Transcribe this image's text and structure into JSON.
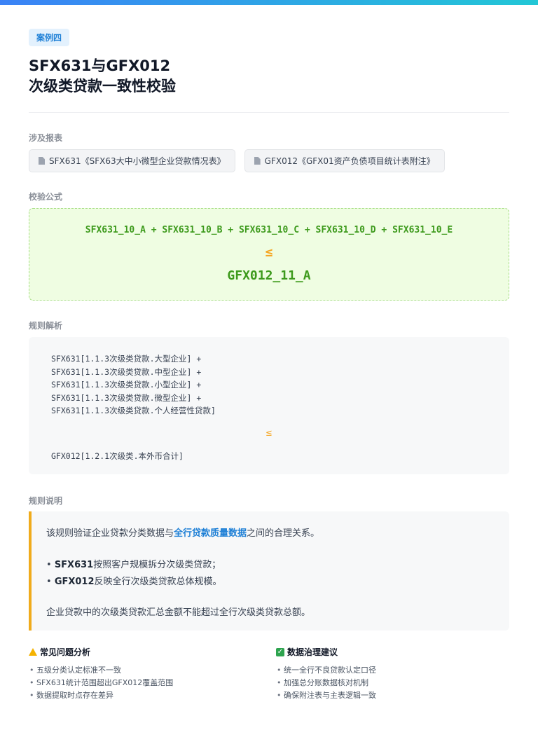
{
  "case_tag": "案例四",
  "title": {
    "line1": "SFX631与GFX012",
    "line2": "次级类贷款一致性校验"
  },
  "sections": {
    "reports": "涉及报表",
    "formula": "校验公式",
    "analysis": "规则解析",
    "description": "规则说明"
  },
  "reports": [
    {
      "label": "SFX631《SFX63大中小微型企业贷款情况表》",
      "icon": "document-icon"
    },
    {
      "label": "GFX012《GFX01资产负债项目统计表附注》",
      "icon": "document-icon"
    }
  ],
  "formula": {
    "top": "SFX631_10_A + SFX631_10_B + SFX631_10_C + SFX631_10_D + SFX631_10_E",
    "op": "≤",
    "result": "GFX012_11_A"
  },
  "analysis": {
    "lines": [
      "SFX631[1.1.3次级类贷款.大型企业] +",
      "SFX631[1.1.3次级类贷款.中型企业] +",
      "SFX631[1.1.3次级类贷款.小型企业] +",
      "SFX631[1.1.3次级类贷款.微型企业] +",
      "SFX631[1.1.3次级类贷款.个人经营性贷款]"
    ],
    "op": "≤",
    "result": "GFX012[1.2.1次级类.本外币合计]"
  },
  "description": {
    "intro_pre": "该规则验证企业贷款分类数据与",
    "intro_highlight": "全行贷款质量数据",
    "intro_post": "之间的合理关系。",
    "bullet1_bold": "SFX631",
    "bullet1_text": "按照客户规模拆分次级类贷款；",
    "bullet2_bold": "GFX012",
    "bullet2_text": "反映全行次级类贷款总体规模。",
    "conclusion": "企业贷款中的次级类贷款汇总金额不能超过全行次级类贷款总额。"
  },
  "issues": {
    "title": "常见问题分析",
    "icon": "warning-icon",
    "items": [
      "五级分类认定标准不一致",
      "SFX631统计范围超出GFX012覆盖范围",
      "数据提取时点存在差异"
    ]
  },
  "suggestions": {
    "title": "数据治理建议",
    "icon": "check-icon",
    "items": [
      "统一全行不良贷款认定口径",
      "加强总分账数据核对机制",
      "确保附注表与主表逻辑一致"
    ]
  },
  "colors": {
    "accent": "#1d7fd6",
    "formula": "#3d9a1c",
    "operator": "#f5a623",
    "border_warn": "#f0ab1c"
  }
}
